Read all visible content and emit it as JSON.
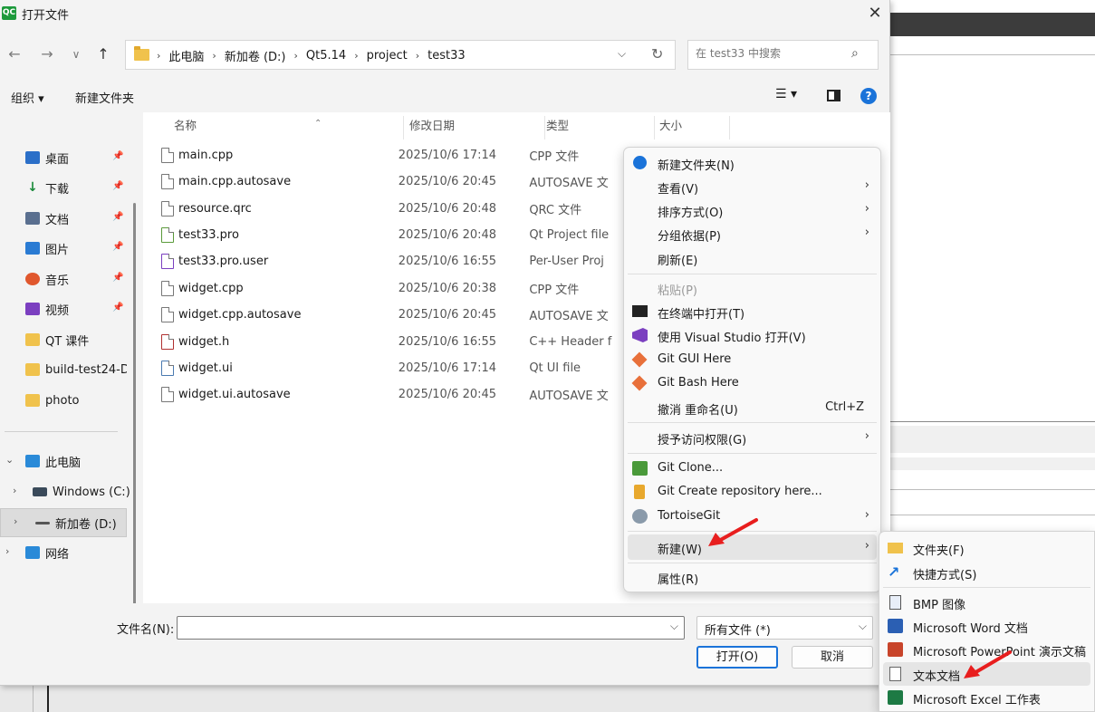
{
  "dialog": {
    "title": "打开文件",
    "close": "✕"
  },
  "nav": {
    "back": "←",
    "forward": "→",
    "recent": "∨",
    "up": "↑"
  },
  "address": {
    "crumbs": [
      "此电脑",
      "新加卷 (D:)",
      "Qt5.14",
      "project",
      "test33"
    ],
    "dropdown": "⌵",
    "refresh": "↻"
  },
  "search": {
    "placeholder": "在 test33 中搜索"
  },
  "toolbar": {
    "organize": "组织 ▾",
    "new_folder": "新建文件夹"
  },
  "sidebar": {
    "items": [
      {
        "label": "桌面",
        "color": "#2b6fc8"
      },
      {
        "label": "下载",
        "color": "#1a8a3a"
      },
      {
        "label": "文档",
        "color": "#5a6f8f"
      },
      {
        "label": "图片",
        "color": "#2a7bd3"
      },
      {
        "label": "音乐",
        "color": "#e0572d"
      },
      {
        "label": "视频",
        "color": "#7b3fc0"
      },
      {
        "label": "QT 课件",
        "color": "#f0c24c"
      },
      {
        "label": "build-test24-D",
        "color": "#f0c24c"
      },
      {
        "label": "photo",
        "color": "#f0c24c"
      }
    ],
    "pin": "📌",
    "drives": [
      {
        "label": "此电脑",
        "chev": "⌄"
      },
      {
        "label": "Windows (C:)",
        "chev": "›"
      },
      {
        "label": "新加卷 (D:)",
        "chev": "›"
      },
      {
        "label": "网络",
        "chev": "›"
      }
    ]
  },
  "columns": {
    "name": "名称",
    "date": "修改日期",
    "type": "类型",
    "size": "大小",
    "sort": "⌃"
  },
  "files": [
    {
      "name": "main.cpp",
      "date": "2025/10/6 17:14",
      "type": "CPP 文件"
    },
    {
      "name": "main.cpp.autosave",
      "date": "2025/10/6 20:45",
      "type": "AUTOSAVE 文"
    },
    {
      "name": "resource.qrc",
      "date": "2025/10/6 20:48",
      "type": "QRC 文件"
    },
    {
      "name": "test33.pro",
      "date": "2025/10/6 20:48",
      "type": "Qt Project file"
    },
    {
      "name": "test33.pro.user",
      "date": "2025/10/6 16:55",
      "type": "Per-User Proj"
    },
    {
      "name": "widget.cpp",
      "date": "2025/10/6 20:38",
      "type": "CPP 文件"
    },
    {
      "name": "widget.cpp.autosave",
      "date": "2025/10/6 20:45",
      "type": "AUTOSAVE 文"
    },
    {
      "name": "widget.h",
      "date": "2025/10/6 16:55",
      "type": "C++ Header f"
    },
    {
      "name": "widget.ui",
      "date": "2025/10/6 17:14",
      "type": "Qt UI file"
    },
    {
      "name": "widget.ui.autosave",
      "date": "2025/10/6 20:45",
      "type": "AUTOSAVE 文"
    }
  ],
  "footer": {
    "filename_label": "文件名(N):",
    "filename_value": "",
    "filetype": "所有文件 (*)",
    "open": "打开(O)",
    "cancel": "取消"
  },
  "context_menu": {
    "items": [
      {
        "label": "新建文件夹(N)"
      },
      {
        "label": "查看(V)",
        "arrow": "›"
      },
      {
        "label": "排序方式(O)",
        "arrow": "›"
      },
      {
        "label": "分组依据(P)",
        "arrow": "›"
      },
      {
        "label": "刷新(E)"
      },
      {
        "label": "粘贴(P)"
      },
      {
        "label": "在终端中打开(T)"
      },
      {
        "label": "使用 Visual Studio 打开(V)"
      },
      {
        "label": "Git GUI Here"
      },
      {
        "label": "Git Bash Here"
      },
      {
        "label": "撤消 重命名(U)",
        "shortcut": "Ctrl+Z"
      },
      {
        "label": "授予访问权限(G)",
        "arrow": "›"
      },
      {
        "label": "Git Clone..."
      },
      {
        "label": "Git Create repository here..."
      },
      {
        "label": "TortoiseGit",
        "arrow": "›"
      },
      {
        "label": "新建(W)",
        "arrow": "›"
      },
      {
        "label": "属性(R)"
      }
    ]
  },
  "submenu": {
    "items": [
      {
        "label": "文件夹(F)"
      },
      {
        "label": "快捷方式(S)"
      },
      {
        "label": "BMP 图像"
      },
      {
        "label": "Microsoft Word 文档"
      },
      {
        "label": "Microsoft PowerPoint 演示文稿"
      },
      {
        "label": "文本文档"
      },
      {
        "label": "Microsoft Excel 工作表"
      }
    ]
  },
  "colors": {
    "accent": "#1a73d9",
    "arrow": "#e81e1e"
  }
}
